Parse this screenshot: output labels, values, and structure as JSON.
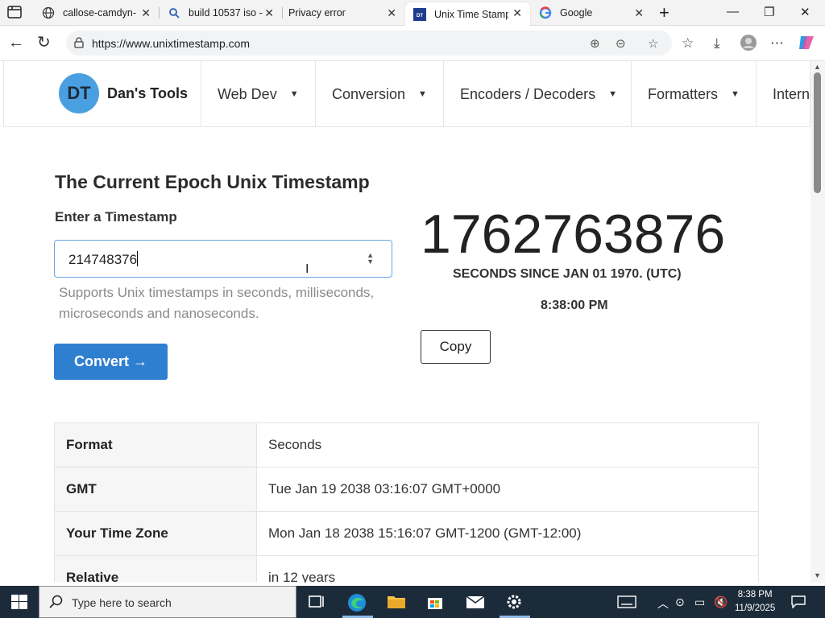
{
  "browser": {
    "tabs": [
      {
        "title": "callose-camdyn-",
        "icon": "globe-icon",
        "active": false
      },
      {
        "title": "build 10537 iso -",
        "icon": "search-icon",
        "active": false
      },
      {
        "title": "Privacy error",
        "icon": "none",
        "active": false
      },
      {
        "title": "Unix Time Stamp",
        "icon": "dans-tools-icon",
        "active": true
      },
      {
        "title": "Google",
        "icon": "google-icon",
        "active": false
      }
    ],
    "url": "https://www.unixtimestamp.com"
  },
  "site": {
    "logo_initials": "DT",
    "logo_name": "Dan's Tools",
    "nav": [
      "Web Dev",
      "Conversion",
      "Encoders / Decoders",
      "Formatters",
      "Interne"
    ]
  },
  "main": {
    "title": "The Current Epoch Unix Timestamp",
    "input_label": "Enter a Timestamp",
    "input_value": "214748376",
    "helper": "Supports Unix timestamps in seconds, milliseconds, microseconds and nanoseconds.",
    "convert_label": "Convert →",
    "epoch": "1762763876",
    "since_label": "SECONDS SINCE JAN 01 1970. (UTC)",
    "clock": "8:38:00 PM",
    "copy_label": "Copy"
  },
  "results": [
    {
      "key": "Format",
      "value": "Seconds"
    },
    {
      "key": "GMT",
      "value": "Tue Jan 19 2038 03:16:07 GMT+0000"
    },
    {
      "key": "Your Time Zone",
      "value": "Mon Jan 18 2038 15:16:07 GMT-1200 (GMT-12:00)"
    },
    {
      "key": "Relative",
      "value": "in 12 years"
    }
  ],
  "taskbar": {
    "search_placeholder": "Type here to search",
    "time": "8:38 PM",
    "date": "11/9/2025"
  },
  "colors": {
    "accent": "#2f7fd0",
    "logo": "#4a9fe0",
    "taskbar": "#1c2b3a"
  }
}
